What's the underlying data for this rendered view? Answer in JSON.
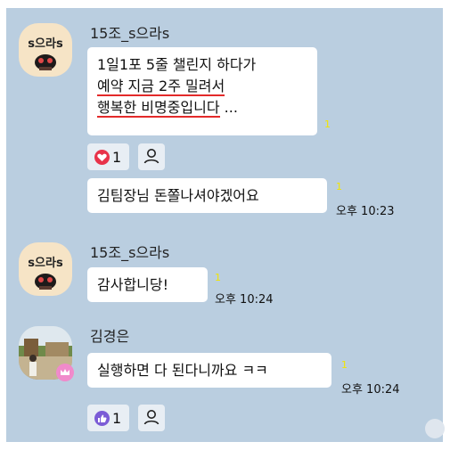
{
  "messages": {
    "m1": {
      "sender": "15조_s으라s",
      "avatar_text": "s으라s",
      "lines": [
        "1일1포 5줄 챌린지 하다가",
        "예약 지금 2주 밀려서",
        "행복한 비명중입니다",
        " ..."
      ],
      "unread": "1",
      "reaction_icon": "heart-icon",
      "reaction_color": "#e8334a",
      "reaction_count": "1"
    },
    "m2": {
      "text": "김팀장님 돈쫄나셔야겠어요",
      "unread": "1",
      "time": "오후 10:23"
    },
    "m3": {
      "sender": "15조_s으라s",
      "avatar_text": "s으라s",
      "text": "감사합니당!",
      "unread": "1",
      "time": "오후 10:24"
    },
    "m4": {
      "sender": "김경은",
      "text": "실행하면 다 된다니까요 ㅋㅋ",
      "unread": "1",
      "time": "오후 10:24",
      "reaction_icon": "thumbs-up-icon",
      "reaction_color": "#7b5cd6",
      "reaction_count": "1"
    }
  },
  "colors": {
    "chat_background": "#bacee0",
    "bubble": "#ffffff",
    "unread_count": "#f2e500",
    "highlight_underline": "#e32a2a"
  }
}
